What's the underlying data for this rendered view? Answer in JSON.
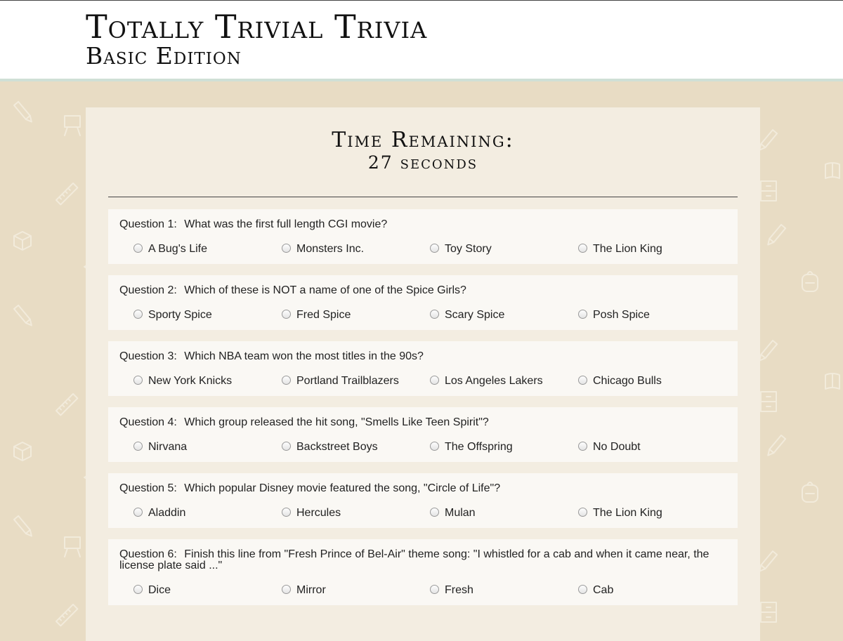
{
  "header": {
    "title": "Totally Trivial Trivia",
    "subtitle": "Basic Edition"
  },
  "timer": {
    "label": "Time Remaining:",
    "value": "27",
    "unit": "seconds"
  },
  "questions": [
    {
      "number": "Question 1:",
      "text": "What was the first full length CGI movie?",
      "options": [
        "A Bug's Life",
        "Monsters Inc.",
        "Toy Story",
        "The Lion King"
      ]
    },
    {
      "number": "Question 2:",
      "text": "Which of these is NOT a name of one of the Spice Girls?",
      "options": [
        "Sporty Spice",
        "Fred Spice",
        "Scary Spice",
        "Posh Spice"
      ]
    },
    {
      "number": "Question 3:",
      "text": "Which NBA team won the most titles in the 90s?",
      "options": [
        "New York Knicks",
        "Portland Trailblazers",
        "Los Angeles Lakers",
        "Chicago Bulls"
      ]
    },
    {
      "number": "Question 4:",
      "text": "Which group released the hit song, \"Smells Like Teen Spirit\"?",
      "options": [
        "Nirvana",
        "Backstreet Boys",
        "The Offspring",
        "No Doubt"
      ]
    },
    {
      "number": "Question 5:",
      "text": "Which popular Disney movie featured the song, \"Circle of Life\"?",
      "options": [
        "Aladdin",
        "Hercules",
        "Mulan",
        "The Lion King"
      ]
    },
    {
      "number": "Question 6:",
      "text": "Finish this line from \"Fresh Prince of Bel-Air\" theme song: \"I whistled for a cab and when it came near, the license plate said ...\"",
      "options": [
        "Dice",
        "Mirror",
        "Fresh",
        "Cab"
      ]
    }
  ],
  "colors": {
    "background": "#e8dcc4",
    "panel": "#f3ede1",
    "card": "#faf8f4",
    "header_border": "#cfe0d6"
  },
  "background_icons": [
    "pencil-icon",
    "easel-icon",
    "book-icon",
    "ruler-icon",
    "backpack-icon",
    "graduation-cap-icon",
    "cabinet-icon"
  ]
}
